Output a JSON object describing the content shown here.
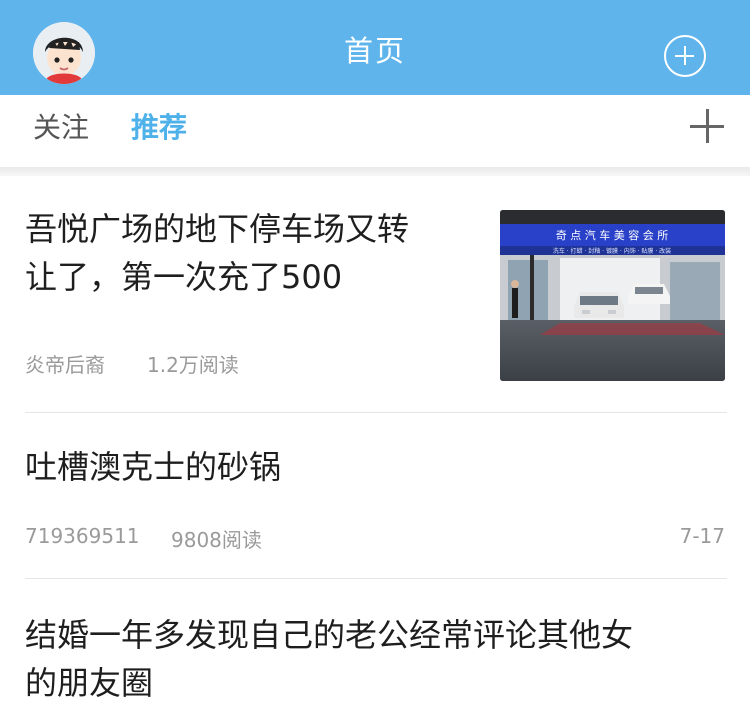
{
  "header": {
    "title": "首页"
  },
  "tabs": [
    {
      "label": "关注"
    },
    {
      "label": "推荐",
      "active": true
    }
  ],
  "feed": [
    {
      "title_line1": "吾悦广场的地下停车场又转",
      "title_line2": "让了，第一次充了500",
      "author": "炎帝后裔",
      "reads": "1.2万阅读",
      "thumbnail": {
        "signboard": "奇 点 汽 车 美 容 会 所",
        "subline": "洗车 · 打蜡 · 封釉 · 镀膜 · 内饰 · 贴膜 · 改装"
      }
    },
    {
      "title": "吐槽澳克士的砂锅",
      "author": "719369511",
      "reads": "9808阅读",
      "date": "7-17"
    },
    {
      "title_line1": "结婚一年多发现自己的老公经常评论其他女",
      "title_line2": "的朋友圈"
    }
  ],
  "colors": {
    "header_bg": "#5fb4ec",
    "active_tab": "#4eb1ea",
    "meta_text": "#9a9a9a"
  }
}
